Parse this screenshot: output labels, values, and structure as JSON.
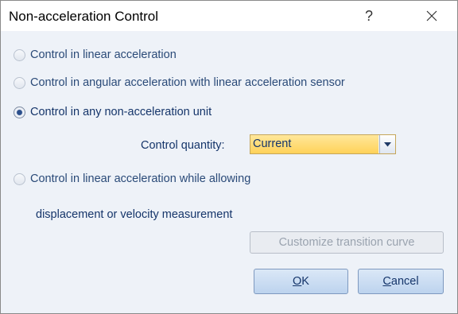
{
  "window": {
    "title": "Non-acceleration Control",
    "help_label": "?"
  },
  "options": {
    "linear": "Control in linear acceleration",
    "angular": "Control in angular acceleration with linear acceleration sensor",
    "non_accel": "Control in any non-acceleration  unit",
    "linear_allowing_line1": "Control in linear acceleration while allowing",
    "linear_allowing_line2": "displacement or velocity measurement",
    "selected": "non_accel"
  },
  "control_quantity": {
    "label": "Control quantity:",
    "value": "Current"
  },
  "buttons": {
    "customize": "Customize transition curve",
    "ok_mnemonic": "O",
    "ok_rest": "K",
    "cancel_mnemonic": "C",
    "cancel_rest": "ancel"
  },
  "colors": {
    "text": "#15356a",
    "combo_fill": "#ffd259",
    "dialog_bg": "#eef2f8"
  }
}
